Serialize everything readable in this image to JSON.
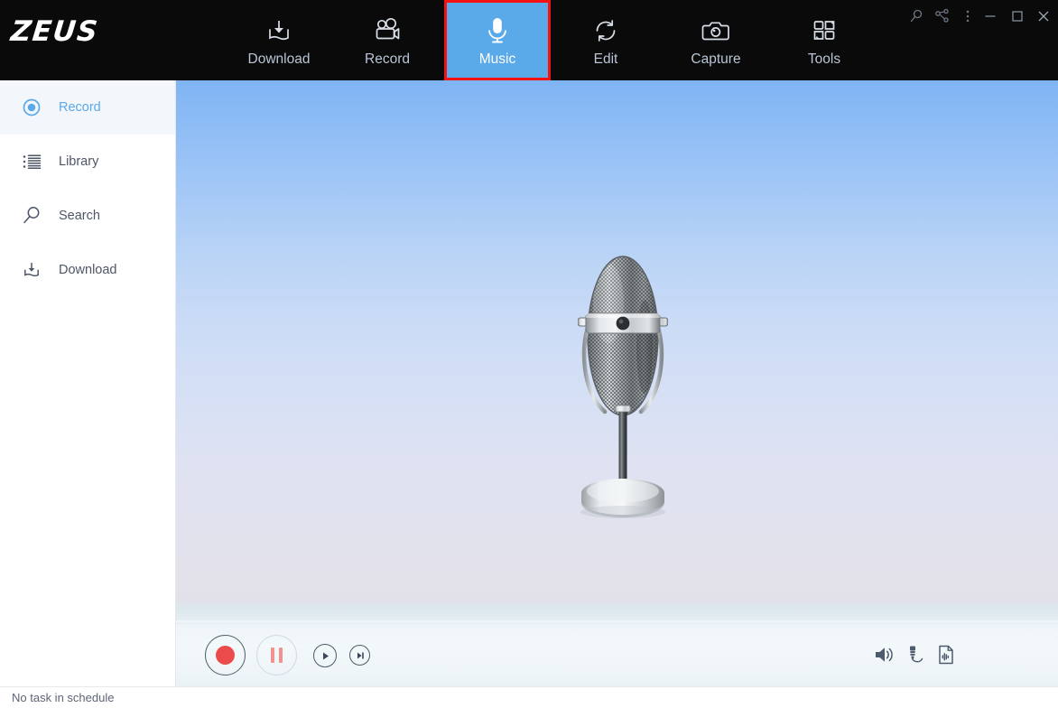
{
  "app": {
    "logo": "ZEUS"
  },
  "toolbar": {
    "items": [
      {
        "label": "Download",
        "icon": "download-tray-icon",
        "active": false
      },
      {
        "label": "Record",
        "icon": "movie-camera-icon",
        "active": false
      },
      {
        "label": "Music",
        "icon": "microphone-icon",
        "active": true
      },
      {
        "label": "Edit",
        "icon": "refresh-convert-icon",
        "active": false
      },
      {
        "label": "Capture",
        "icon": "photo-camera-icon",
        "active": false
      },
      {
        "label": "Tools",
        "icon": "grid-squares-icon",
        "active": false
      }
    ],
    "active_highlight_color": "#f41212",
    "active_background_color": "#5aa9e9",
    "background_color": "#0a0a0a",
    "label_color": "#b9c5d6"
  },
  "window_controls": [
    {
      "name": "search-icon",
      "glyph": "search"
    },
    {
      "name": "share-icon",
      "glyph": "share"
    },
    {
      "name": "more-menu-icon",
      "glyph": "kebab"
    },
    {
      "name": "minimize-button",
      "glyph": "minimize"
    },
    {
      "name": "maximize-button",
      "glyph": "maximize"
    },
    {
      "name": "close-button",
      "glyph": "close"
    }
  ],
  "sidebar": {
    "items": [
      {
        "label": "Record",
        "icon": "record-circle-icon",
        "active": true
      },
      {
        "label": "Library",
        "icon": "list-icon",
        "active": false
      },
      {
        "label": "Search",
        "icon": "magnifier-icon",
        "active": false
      },
      {
        "label": "Download",
        "icon": "download-tray-icon",
        "active": false
      }
    ],
    "active_text_color": "#5aa9e9",
    "active_background_color": "#f3f7fb"
  },
  "content": {
    "illustration": "vintage-microphone",
    "background_top_color": "#7fb4f3",
    "background_bottom_color": "#fdfeff"
  },
  "controls": {
    "transport": [
      {
        "name": "record-button",
        "label": "Record",
        "state": "enabled",
        "accent": "#eb4b4b"
      },
      {
        "name": "pause-button",
        "label": "Pause",
        "state": "disabled",
        "accent": "#f2918e"
      },
      {
        "name": "play-button",
        "label": "Play",
        "state": "enabled",
        "accent": "#3c4858"
      },
      {
        "name": "next-button",
        "label": "Next",
        "state": "enabled",
        "accent": "#3c4858"
      }
    ],
    "right_icons": [
      {
        "name": "volume-speaker-icon",
        "label": "Volume"
      },
      {
        "name": "audio-jack-icon",
        "label": "Audio Input"
      },
      {
        "name": "audio-file-icon",
        "label": "Output File"
      }
    ]
  },
  "status": {
    "text": "No task in schedule"
  }
}
